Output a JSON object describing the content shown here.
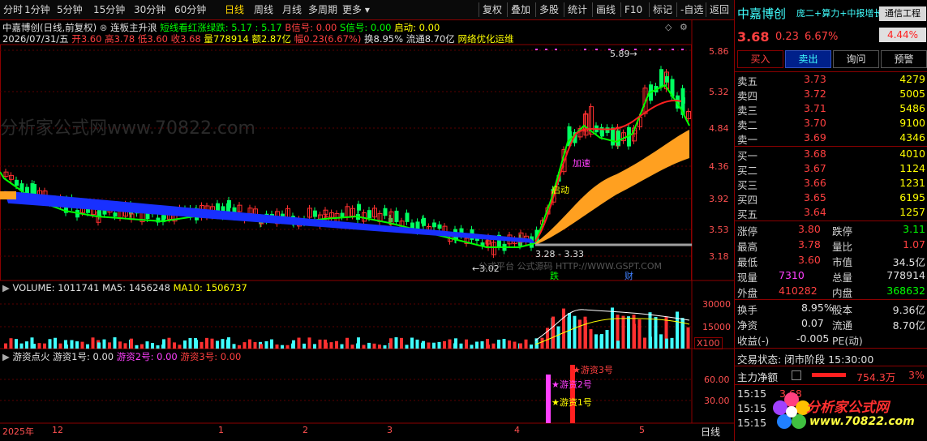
{
  "toolbar": {
    "left_items": [
      "分时",
      "1分钟",
      "5分钟",
      "15分钟",
      "30分钟",
      "60分钟",
      "日线",
      "周线",
      "月线",
      "多周期",
      "更多"
    ],
    "active": "日线",
    "right_items": [
      "复权",
      "叠加",
      "多股",
      "统计",
      "画线",
      "F10",
      "标记",
      "-自选",
      "返回"
    ]
  },
  "header": {
    "stock_title": "中嘉博创(日线,前复权)",
    "indicator_name": "连板主升浪",
    "indicator_vals": "短线看红涨绿跌: 5.17 : 5.17",
    "b_signal": "B信号: 0.00",
    "s_signal": "S信号: 0.00",
    "start": "启动: 0.00",
    "date": "2026/07/31/五",
    "open": "开3.60",
    "high": "高3.78",
    "low": "低3.60",
    "close": "收3.68",
    "volume": "量778914",
    "amount": "额2.87亿",
    "change": "幅0.23(6.67%)",
    "turnover": "换8.95%",
    "float": "流通8.70亿",
    "concept": "网络优化运维"
  },
  "price_axis": [
    "5.86",
    "5.32",
    "4.84",
    "4.36",
    "3.92",
    "3.53",
    "3.18"
  ],
  "annotations": {
    "max_label": "5.89",
    "min_label": "←3.02",
    "range_label": "3.28 - 3.33",
    "start_label": "启动",
    "speed_label": "加速",
    "fall_tag": "跌",
    "fin_tag": "财",
    "watermark_text": "分析家公式网www.70822.com",
    "platform_text": "公式平台 公式源码 HTTP://WWW.GSPT.COM"
  },
  "volume_panel": {
    "label": "VOLUME: 1011741",
    "ma5": "MA5: 1456248",
    "ma10": "MA10: 1506737",
    "axis": [
      "30000",
      "15000"
    ],
    "unit": "X100"
  },
  "hot_money_panel": {
    "title": "游资点火",
    "y1": "游资1号: 0.00",
    "y2": "游资2号: 0.00",
    "y3": "游资3号: 0.00",
    "axis": [
      "60.00",
      "30.00"
    ],
    "tag1": "★游资1号",
    "tag2": "★游资2号",
    "tag3": "★游资3号"
  },
  "date_axis": [
    "2025年",
    "12",
    "1",
    "2",
    "3",
    "4",
    "5"
  ],
  "period_label": "日线",
  "quote": {
    "name": "中嘉博创",
    "tags": "庞二+算力+中报增长",
    "sector": "通信工程",
    "sector_pct": "4.44%",
    "price": "3.68",
    "chg": "0.23",
    "pct": "6.67%",
    "buttons": [
      "买入",
      "卖出",
      "询问",
      "预警"
    ],
    "asks": [
      {
        "label": "卖五",
        "price": "3.73",
        "qty": "4279"
      },
      {
        "label": "卖四",
        "price": "3.72",
        "qty": "5005"
      },
      {
        "label": "卖三",
        "price": "3.71",
        "qty": "5486"
      },
      {
        "label": "卖二",
        "price": "3.70",
        "qty": "9100"
      },
      {
        "label": "卖一",
        "price": "3.69",
        "qty": "4346"
      }
    ],
    "bids": [
      {
        "label": "买一",
        "price": "3.68",
        "qty": "4010"
      },
      {
        "label": "买二",
        "price": "3.67",
        "qty": "1124"
      },
      {
        "label": "买三",
        "price": "3.66",
        "qty": "1231"
      },
      {
        "label": "买四",
        "price": "3.65",
        "qty": "6195"
      },
      {
        "label": "买五",
        "price": "3.64",
        "qty": "1257"
      }
    ],
    "stats": [
      {
        "k1": "涨停",
        "v1": "3.80",
        "k2": "跌停",
        "v2": "3.11"
      },
      {
        "k1": "最高",
        "v1": "3.78",
        "k2": "量比",
        "v2": "1.07"
      },
      {
        "k1": "最低",
        "v1": "3.60",
        "k2": "市值",
        "v2": "34.5亿"
      },
      {
        "k1": "现量",
        "v1": "7310",
        "k2": "总量",
        "v2": "778914"
      },
      {
        "k1": "外盘",
        "v1": "410282",
        "k2": "内盘",
        "v2": "368632"
      }
    ],
    "stats2": [
      {
        "k1": "换手",
        "v1": "8.95%",
        "k2": "股本",
        "v2": "9.36亿"
      },
      {
        "k1": "净资",
        "v1": "0.07",
        "k2": "流通",
        "v2": "8.70亿"
      },
      {
        "k1": "收益(-)",
        "v1": "-0.005",
        "k2": "PE(动)",
        "v2": ""
      }
    ],
    "trade_status": "交易状态: 闭市阶段 15:30:00",
    "main_net_label": "主力净额",
    "main_net_value": "754.3万",
    "main_net_pct": "3%",
    "ticks": [
      {
        "time": "15:15",
        "val": "3.68"
      },
      {
        "time": "15:15",
        "val": ""
      },
      {
        "time": "15:15",
        "val": ""
      }
    ],
    "logo_text": "分析家公式网",
    "logo_url": "www.70822.com"
  }
}
